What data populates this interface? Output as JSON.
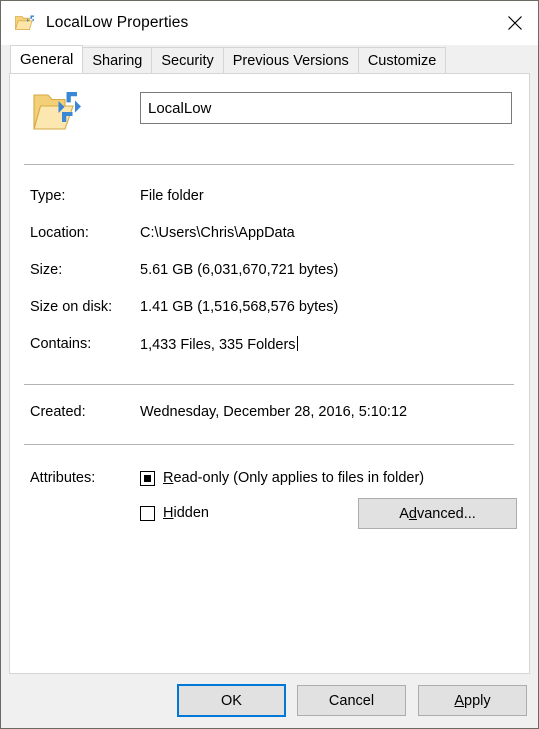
{
  "window": {
    "title": "LocalLow Properties",
    "icon": "folder-compressed-icon",
    "close_icon": "close-icon"
  },
  "tabs": [
    {
      "label": "General",
      "active": true
    },
    {
      "label": "Sharing",
      "active": false
    },
    {
      "label": "Security",
      "active": false
    },
    {
      "label": "Previous Versions",
      "active": false
    },
    {
      "label": "Customize",
      "active": false
    }
  ],
  "general": {
    "folder_icon": "folder-compressed-icon",
    "name_value": "LocalLow",
    "name_placeholder": "",
    "properties": [
      {
        "label": "Type:",
        "value": "File folder"
      },
      {
        "label": "Location:",
        "value": "C:\\Users\\Chris\\AppData"
      },
      {
        "label": "Size:",
        "value": "5.61 GB (6,031,670,721 bytes)"
      },
      {
        "label": "Size on disk:",
        "value": "1.41 GB (1,516,568,576 bytes)"
      },
      {
        "label": "Contains:",
        "value": "1,433 Files, 335 Folders"
      }
    ],
    "created": {
      "label": "Created:",
      "value": "Wednesday, December 28, 2016, 5:10:12"
    },
    "attributes": {
      "label": "Attributes:",
      "readonly": {
        "accel": "R",
        "rest": "ead-only (Only applies to files in folder)",
        "state": "indeterminate"
      },
      "hidden": {
        "accel": "H",
        "rest": "idden",
        "state": "unchecked"
      },
      "advanced_button": {
        "pre": "A",
        "accel": "d",
        "post": "vanced..."
      }
    }
  },
  "footer": {
    "ok_label": "OK",
    "cancel_label": "Cancel",
    "apply": {
      "accel": "A",
      "rest": "pply"
    }
  },
  "colors": {
    "accent": "#0078d7",
    "dialog_bg": "#f0f0f0",
    "panel_bg": "#ffffff",
    "button_face": "#e1e1e1",
    "folder_yellow": "#ffd16b",
    "arrow_blue": "#2f7fd1"
  }
}
